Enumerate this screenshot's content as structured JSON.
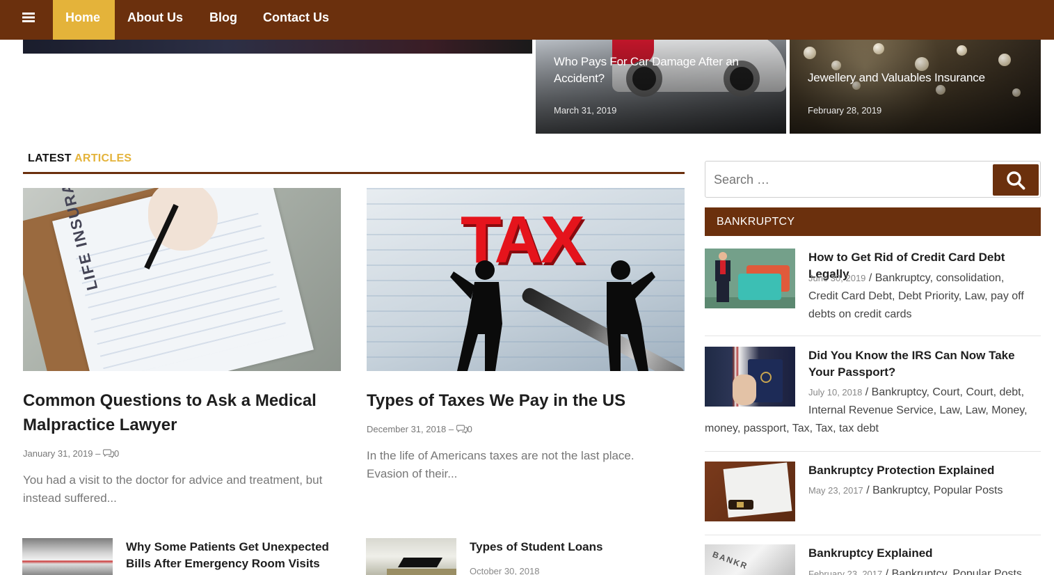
{
  "nav": {
    "menu_icon": "hamburger-icon",
    "items": [
      {
        "label": "Home",
        "active": true
      },
      {
        "label": "About Us",
        "active": false
      },
      {
        "label": "Blog",
        "active": false
      },
      {
        "label": "Contact Us",
        "active": false
      }
    ],
    "colors": {
      "bar": "#6b300d",
      "active": "#e4b33a"
    }
  },
  "featured": [
    {
      "title": "Who Pays For Car Damage After an Accident?",
      "date": "March 31, 2019"
    },
    {
      "title": "Jewellery and Valuables Insurance",
      "date": "February 28, 2019"
    }
  ],
  "latest": {
    "heading_part1": "LATEST",
    "heading_part2": "ARTICLES",
    "cards": [
      {
        "title": "Common Questions to Ask a Medical Malpractice Lawyer",
        "date": "January 31, 2019",
        "separator": "–",
        "comments": "0",
        "excerpt": "You had a visit to the doctor for advice and treatment, but instead suffered...",
        "image_text": "LIFE INSURANCE"
      },
      {
        "title": "Types of Taxes We Pay in the US",
        "date": "December 31, 2018",
        "separator": "–",
        "comments": "0",
        "excerpt": "In the life of Americans taxes are not the last place. Evasion of their...",
        "image_text": "TAX"
      }
    ],
    "small_items": [
      {
        "title": "Why Some Patients Get Unexpected Bills After Emergency Room Visits",
        "date": ""
      },
      {
        "title": "Types of Student Loans",
        "date": "October 30, 2018"
      }
    ]
  },
  "sidebar": {
    "search": {
      "placeholder": "Search …",
      "button_icon": "search-icon"
    },
    "category_heading": "BANKRUPTCY",
    "items": [
      {
        "title": "How to Get Rid of Credit Card Debt Legally",
        "date": "June 30, 2019",
        "tags_line1": " / Bankruptcy, consolidation,",
        "tags_line2": "Credit Card Debt, Debt Priority, Law, pay off",
        "tags_line3": "debts on credit cards"
      },
      {
        "title": "Did You Know the IRS Can Now Take Your Passport?",
        "date": "July 10, 2018",
        "tags_line1": " / Bankruptcy, Court, Court, debt,",
        "tags_line2": "Internal Revenue Service, Law, Law, Money,",
        "tags_line3": "money, passport, Tax, Tax, tax debt"
      },
      {
        "title": "Bankruptcy Protection Explained",
        "date": "May 23, 2017",
        "tags_line1": " / Bankruptcy, Popular Posts"
      },
      {
        "title": "Bankruptcy Explained",
        "date": "February 23, 2017",
        "tags_line1": " / Bankruptcy, Popular Posts"
      }
    ]
  }
}
